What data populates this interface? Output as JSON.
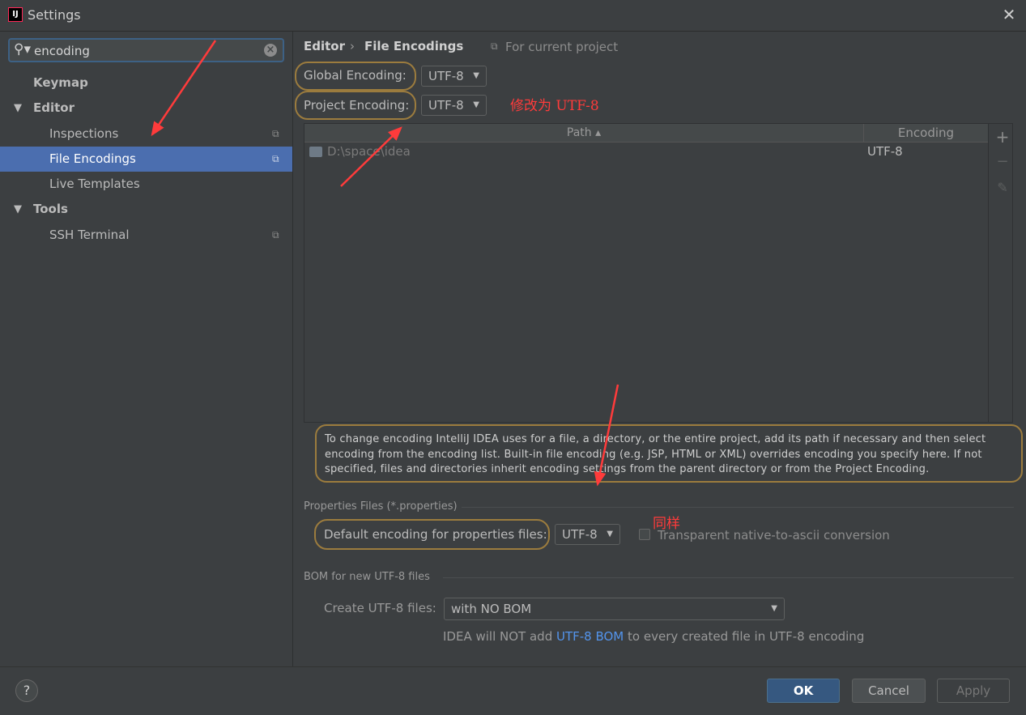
{
  "window": {
    "title": "Settings",
    "app_icon": "IJ",
    "close": "✕"
  },
  "search": {
    "value": "encoding"
  },
  "sidebar": {
    "items": [
      {
        "label": "Keymap"
      },
      {
        "label": "Editor"
      },
      {
        "label": "Inspections"
      },
      {
        "label": "File Encodings"
      },
      {
        "label": "Live Templates"
      },
      {
        "label": "Tools"
      },
      {
        "label": "SSH Terminal"
      }
    ]
  },
  "breadcrumb": {
    "parent": "Editor",
    "separator": "›",
    "current": "File Encodings",
    "scope": "For current project"
  },
  "encoding": {
    "global_label": "Global Encoding:",
    "global_value": "UTF-8",
    "project_label": "Project Encoding:",
    "project_value": "UTF-8",
    "annotation": "修改为 UTF-8"
  },
  "table": {
    "columns": [
      "Path ▴",
      "Encoding"
    ],
    "rows": [
      {
        "path": "D:\\space\\idea",
        "encoding": "UTF-8"
      }
    ],
    "tools": {
      "add": "+",
      "remove": "−",
      "edit": "✎"
    }
  },
  "info_text": "To change encoding IntelliJ IDEA uses for a file, a directory, or the entire project, add its path if necessary and then select encoding from the encoding list. Built-in file encoding (e.g. JSP, HTML or XML) overrides encoding you specify here. If not specified, files and directories inherit encoding settings from the parent directory or from the Project Encoding.",
  "properties": {
    "section_title": "Properties Files (*.properties)",
    "default_label": "Default encoding for properties files:",
    "default_value": "UTF-8",
    "annotation": "同样",
    "transparent_label": "Transparent native-to-ascii conversion"
  },
  "bom": {
    "section_title": "BOM for new UTF-8 files",
    "create_label": "Create UTF-8 files:",
    "create_value": "with NO BOM",
    "note_prefix": "IDEA will NOT add ",
    "note_link": "UTF-8 BOM",
    "note_suffix": " to every created file in UTF-8 encoding"
  },
  "footer": {
    "help": "?",
    "ok": "OK",
    "cancel": "Cancel",
    "apply": "Apply"
  },
  "colors": {
    "accent": "#4b6eaf",
    "annotation": "#ff3b3b",
    "highlight": "#9c7c3e",
    "link": "#5394ec"
  }
}
